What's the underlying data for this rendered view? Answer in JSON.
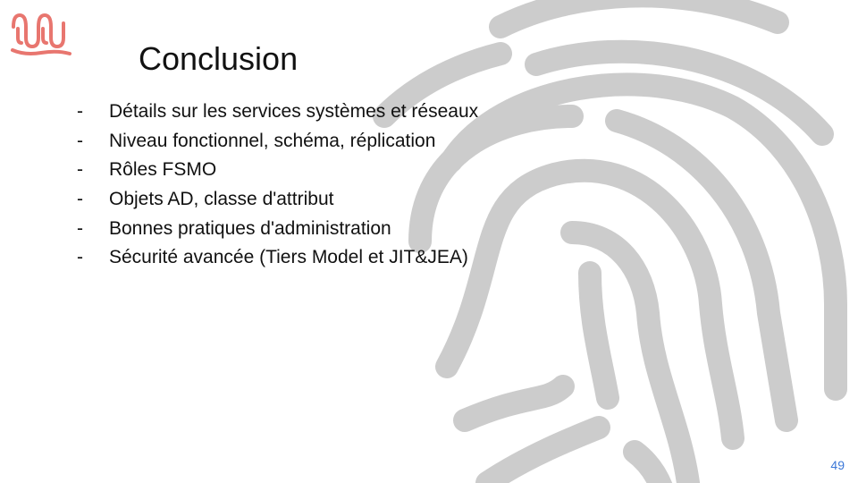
{
  "slide": {
    "title": "Conclusion",
    "bullet_marker": "-",
    "bullets": [
      "Détails sur les services systèmes et réseaux",
      "Niveau fonctionnel, schéma, réplication",
      "Rôles FSMO",
      "Objets AD, classe d'attribut",
      "Bonnes pratiques d'administration",
      "Sécurité avancée (Tiers Model et JIT&JEA)"
    ],
    "page_number": "49"
  },
  "colors": {
    "logo": "#e8766f",
    "fingerprint": "#cccccc",
    "page_number": "#3c78d8",
    "text": "#111111"
  },
  "icons": {
    "logo": "wave-logo-icon",
    "background": "fingerprint-icon"
  }
}
